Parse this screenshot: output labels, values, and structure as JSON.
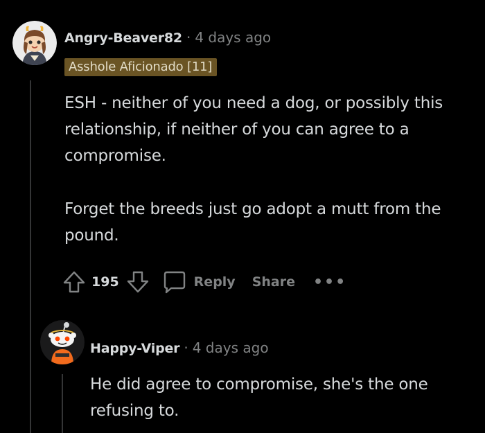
{
  "comments": [
    {
      "author": "Angry-Beaver82",
      "separator": "·",
      "time": "4 days ago",
      "flair": "Asshole Aficionado [11]",
      "paragraphs": [
        "ESH - neither of you need a dog, or possibly this relationship, if neither of you can agree to a compromise.",
        "Forget the breeds just go adopt a mutt from the pound."
      ],
      "votes": "195",
      "reply_label": "Reply",
      "share_label": "Share",
      "more_label": "•••"
    },
    {
      "author": "Happy-Viper",
      "separator": "·",
      "time": "4 days ago",
      "paragraphs": [
        "He did agree to compromise, she's the one refusing to."
      ]
    }
  ],
  "colors": {
    "background": "#000000",
    "text": "#d7dadc",
    "muted": "#818384",
    "flair_bg": "#6a5424",
    "thread_line": "#343536"
  }
}
